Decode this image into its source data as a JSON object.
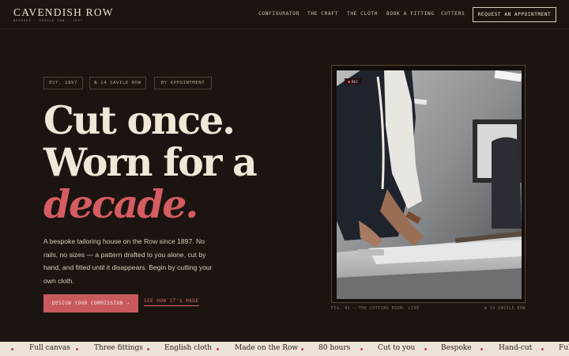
{
  "brand": {
    "name": "CAVENDISH ROW",
    "tagline": "BESPOKE · SAVILE ROW · 1897"
  },
  "nav": {
    "links": [
      "CONFIGURATOR",
      "THE CRAFT",
      "THE CLOTH",
      "BOOK A FITTING",
      "CUTTERS"
    ],
    "cta": "REQUEST AN APPOINTMENT"
  },
  "hero": {
    "tags": [
      "EST. 1897",
      "№ 14 SAVILE ROW",
      "BY APPOINTMENT"
    ],
    "headline_line1": "Cut once.",
    "headline_line2": "Worn for a",
    "headline_accent": "decade.",
    "lede": "A bespoke tailoring house on the Row since 1897. No rails, no sizes — a pattern drafted to you alone, cut by hand, and fitted until it disappears. Begin by cutting your own cloth.",
    "primary_cta": "DESIGN YOUR COMMISSION →",
    "secondary_cta": "SEE HOW IT'S MADE"
  },
  "media": {
    "live_label": "REC",
    "caption_left": "FIG. 01 — THE CUTTING ROOM, LIVE",
    "caption_right": "№ 14 SAVILE ROW"
  },
  "marquee": {
    "items": [
      "Full canvas",
      "Three fittings",
      "English cloth",
      "Made on the Row",
      "80 hours",
      "Cut to you",
      "Bespoke",
      "Hand-cut",
      "Full"
    ]
  },
  "colors": {
    "background": "#1b1410",
    "accent": "#d45c62",
    "cream": "#efe7d7",
    "marquee_bg": "#ece4d6"
  }
}
